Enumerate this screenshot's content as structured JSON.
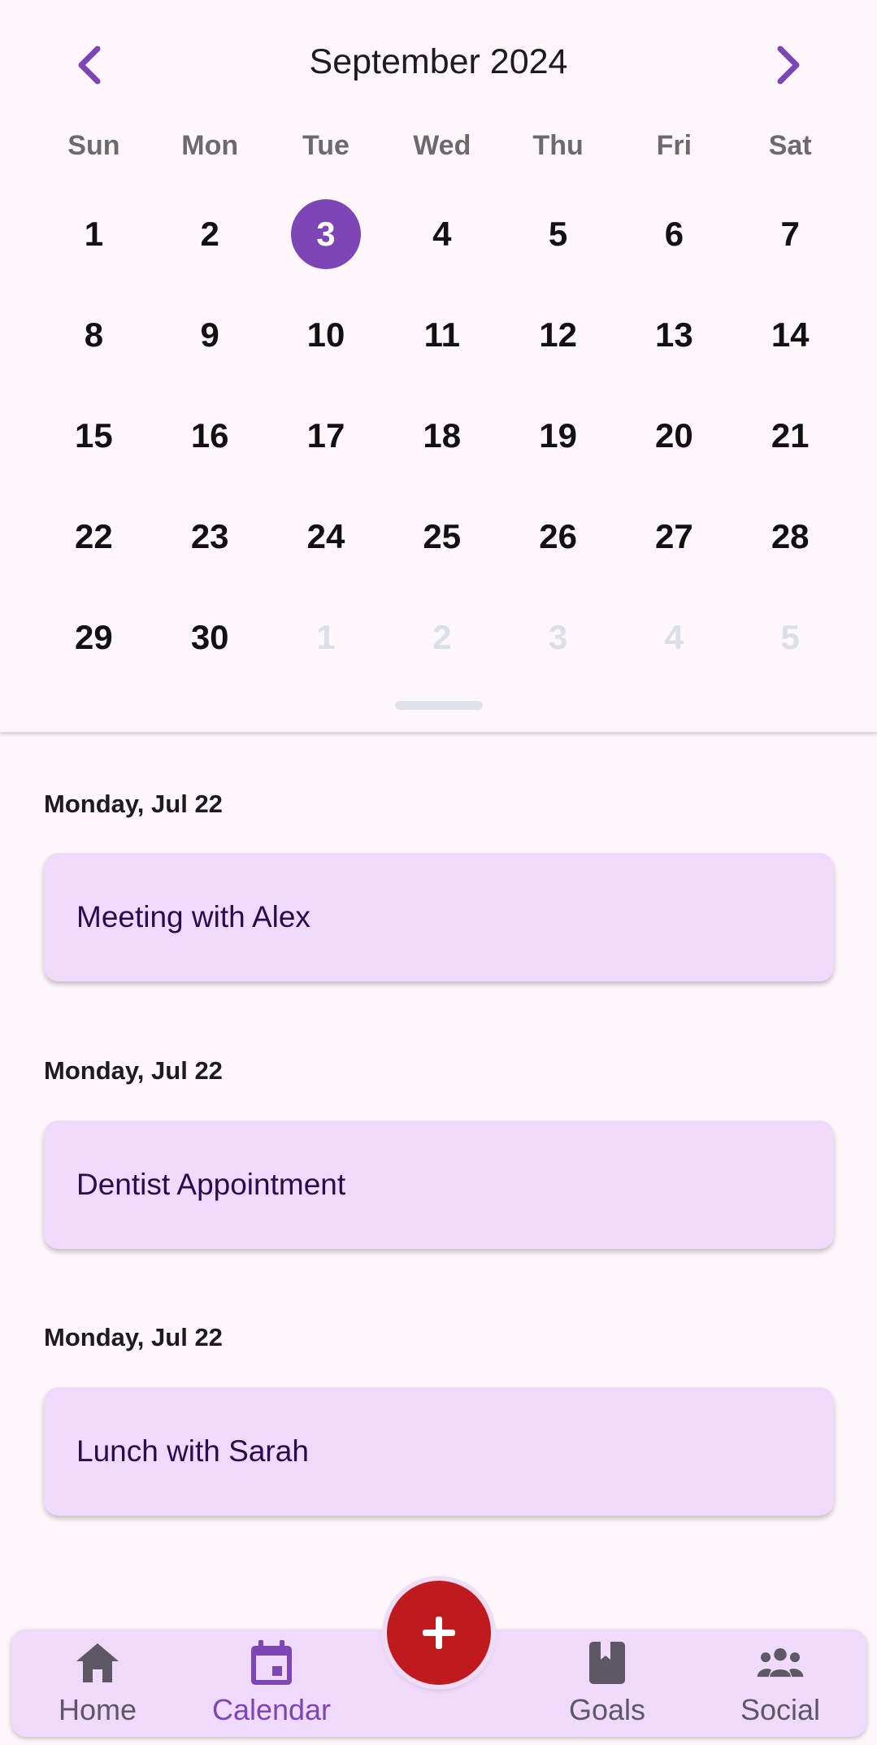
{
  "calendar": {
    "month_title": "September 2024",
    "weekdays": [
      "Sun",
      "Mon",
      "Tue",
      "Wed",
      "Thu",
      "Fri",
      "Sat"
    ],
    "selected_day": "3",
    "days": [
      {
        "n": "1",
        "muted": false
      },
      {
        "n": "2",
        "muted": false
      },
      {
        "n": "3",
        "muted": false
      },
      {
        "n": "4",
        "muted": false
      },
      {
        "n": "5",
        "muted": false
      },
      {
        "n": "6",
        "muted": false
      },
      {
        "n": "7",
        "muted": false
      },
      {
        "n": "8",
        "muted": false
      },
      {
        "n": "9",
        "muted": false
      },
      {
        "n": "10",
        "muted": false
      },
      {
        "n": "11",
        "muted": false
      },
      {
        "n": "12",
        "muted": false
      },
      {
        "n": "13",
        "muted": false
      },
      {
        "n": "14",
        "muted": false
      },
      {
        "n": "15",
        "muted": false
      },
      {
        "n": "16",
        "muted": false
      },
      {
        "n": "17",
        "muted": false
      },
      {
        "n": "18",
        "muted": false
      },
      {
        "n": "19",
        "muted": false
      },
      {
        "n": "20",
        "muted": false
      },
      {
        "n": "21",
        "muted": false
      },
      {
        "n": "22",
        "muted": false
      },
      {
        "n": "23",
        "muted": false
      },
      {
        "n": "24",
        "muted": false
      },
      {
        "n": "25",
        "muted": false
      },
      {
        "n": "26",
        "muted": false
      },
      {
        "n": "27",
        "muted": false
      },
      {
        "n": "28",
        "muted": false
      },
      {
        "n": "29",
        "muted": false
      },
      {
        "n": "30",
        "muted": false
      },
      {
        "n": "1",
        "muted": true
      },
      {
        "n": "2",
        "muted": true
      },
      {
        "n": "3",
        "muted": true
      },
      {
        "n": "4",
        "muted": true
      },
      {
        "n": "5",
        "muted": true
      }
    ],
    "prev_icon": "chevron-left-icon",
    "next_icon": "chevron-right-icon"
  },
  "events": [
    {
      "date": "Monday, Jul 22",
      "title": "Meeting with Alex"
    },
    {
      "date": "Monday, Jul 22",
      "title": "Dentist Appointment"
    },
    {
      "date": "Monday, Jul 22",
      "title": "Lunch with Sarah"
    }
  ],
  "bottom_nav": {
    "home_label": "Home",
    "calendar_label": "Calendar",
    "goals_label": "Goals",
    "social_label": "Social",
    "active": "Calendar",
    "fab_icon": "plus-icon"
  },
  "colors": {
    "accent": "#7d45b5",
    "fab": "#bf1a1e",
    "card": "#efdafb",
    "background": "#fdf7fc"
  }
}
